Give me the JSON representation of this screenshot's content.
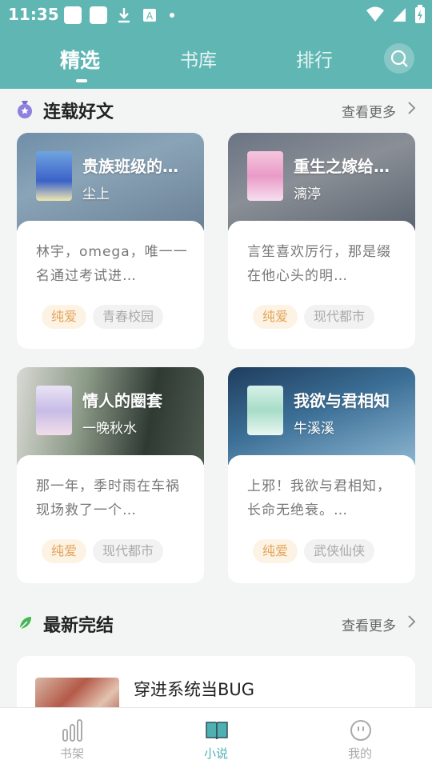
{
  "status_bar": {
    "time": "11:35"
  },
  "top_nav": {
    "tabs": [
      {
        "label": "精选",
        "active": true
      },
      {
        "label": "书库",
        "active": false
      },
      {
        "label": "排行",
        "active": false
      }
    ],
    "search_icon": "search-icon"
  },
  "serial_section": {
    "title": "连载好文",
    "more": "查看更多",
    "icon": "bag-icon"
  },
  "serial_books": [
    {
      "title": "贵族班级的…",
      "author": "尘上",
      "desc": "林宇，omega，唯一一名通过考试进…",
      "tags": [
        "纯爱",
        "青春校园"
      ]
    },
    {
      "title": "重生之嫁给…",
      "author": "漓渟",
      "desc": "言笙喜欢厉行，那是缀在他心头的明…",
      "tags": [
        "纯爱",
        "现代都市"
      ]
    },
    {
      "title": "情人的圈套",
      "author": "一晚秋水",
      "desc": "那一年，季时雨在车祸现场救了一个…",
      "tags": [
        "纯爱",
        "现代都市"
      ]
    },
    {
      "title": "我欲与君相知",
      "author": "牛溪溪",
      "desc": "上邪！我欲与君相知，长命无绝衰。…",
      "tags": [
        "纯爱",
        "武侠仙侠"
      ]
    }
  ],
  "finished_section": {
    "title": "最新完结",
    "more": "查看更多",
    "icon": "leaf-icon"
  },
  "finished_books": [
    {
      "title": "穿进系统当BUG"
    }
  ],
  "bottom_nav": [
    {
      "label": "书架",
      "icon": "bookshelf-icon",
      "active": false
    },
    {
      "label": "小说",
      "icon": "book-icon",
      "active": true
    },
    {
      "label": "我的",
      "icon": "profile-icon",
      "active": false
    }
  ],
  "colors": {
    "brand": "#5fb6b3",
    "active_tab": "#4fb0b2",
    "tag_primary_text": "#e2a45a"
  }
}
